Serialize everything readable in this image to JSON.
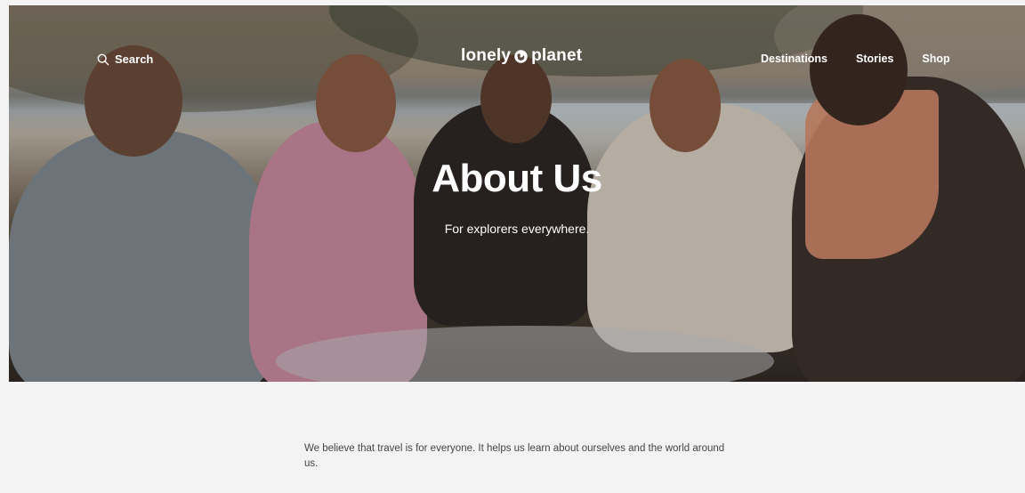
{
  "nav": {
    "search_label": "Search",
    "logo_text_left": "lonely",
    "logo_text_right": "planet",
    "links": [
      "Destinations",
      "Stories",
      "Shop"
    ]
  },
  "hero": {
    "title": "About Us",
    "subtitle": "For explorers everywhere."
  },
  "intro": {
    "text": "We believe that travel is for everyone. It helps us learn about ourselves and the world around us."
  },
  "colors": {
    "page_background": "#f3f3f3",
    "hero_text": "#ffffff",
    "body_text": "#444444"
  },
  "icons": {
    "search": "search-icon",
    "logo_globe": "globe-icon"
  }
}
